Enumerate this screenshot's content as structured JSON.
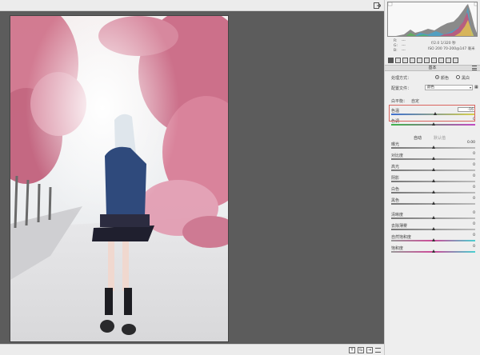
{
  "topbar": {
    "exit_icon": "exit-icon"
  },
  "info": {
    "r_label": "R:",
    "g_label": "G:",
    "b_label": "B:",
    "r_value": "---",
    "g_value": "---",
    "b_value": "---",
    "camera_line1": "f/2.0  1/320 秒",
    "camera_line2": "ISO 200  70-200@147 毫米"
  },
  "panel": {
    "section_title": "基本",
    "processing_label": "处理方式：",
    "color_option": "颜色",
    "bw_option": "黑白",
    "profile_label": "配置文件：",
    "profile_value": "颜色",
    "white_balance_label": "白平衡：",
    "white_balance_value": "自定",
    "auto_label": "自动",
    "default_label": "默认值"
  },
  "sliders": [
    {
      "label": "色温",
      "value": "-16",
      "pos": 0.52,
      "track": "temp"
    },
    {
      "label": "色调",
      "value": "0",
      "pos": 0.5,
      "track": "tint"
    },
    {
      "label": "曝光",
      "value": "0.00",
      "pos": 0.5,
      "track": "gray"
    },
    {
      "label": "对比度",
      "value": "0",
      "pos": 0.5,
      "track": "gray"
    },
    {
      "label": "高光",
      "value": "0",
      "pos": 0.5,
      "track": "gray"
    },
    {
      "label": "阴影",
      "value": "0",
      "pos": 0.5,
      "track": "gray"
    },
    {
      "label": "白色",
      "value": "0",
      "pos": 0.5,
      "track": "gray"
    },
    {
      "label": "黑色",
      "value": "0",
      "pos": 0.5,
      "track": "gray"
    },
    {
      "label": "清晰度",
      "value": "0",
      "pos": 0.5,
      "track": "gray"
    },
    {
      "label": "去除薄雾",
      "value": "0",
      "pos": 0.5,
      "track": "gray"
    },
    {
      "label": "自然饱和度",
      "value": "0",
      "pos": 0.5,
      "track": "sat"
    },
    {
      "label": "饱和度",
      "value": "0",
      "pos": 0.5,
      "track": "sat"
    }
  ],
  "colors": {
    "canvas": "#5c5c5c",
    "highlight": "#d9655f"
  }
}
